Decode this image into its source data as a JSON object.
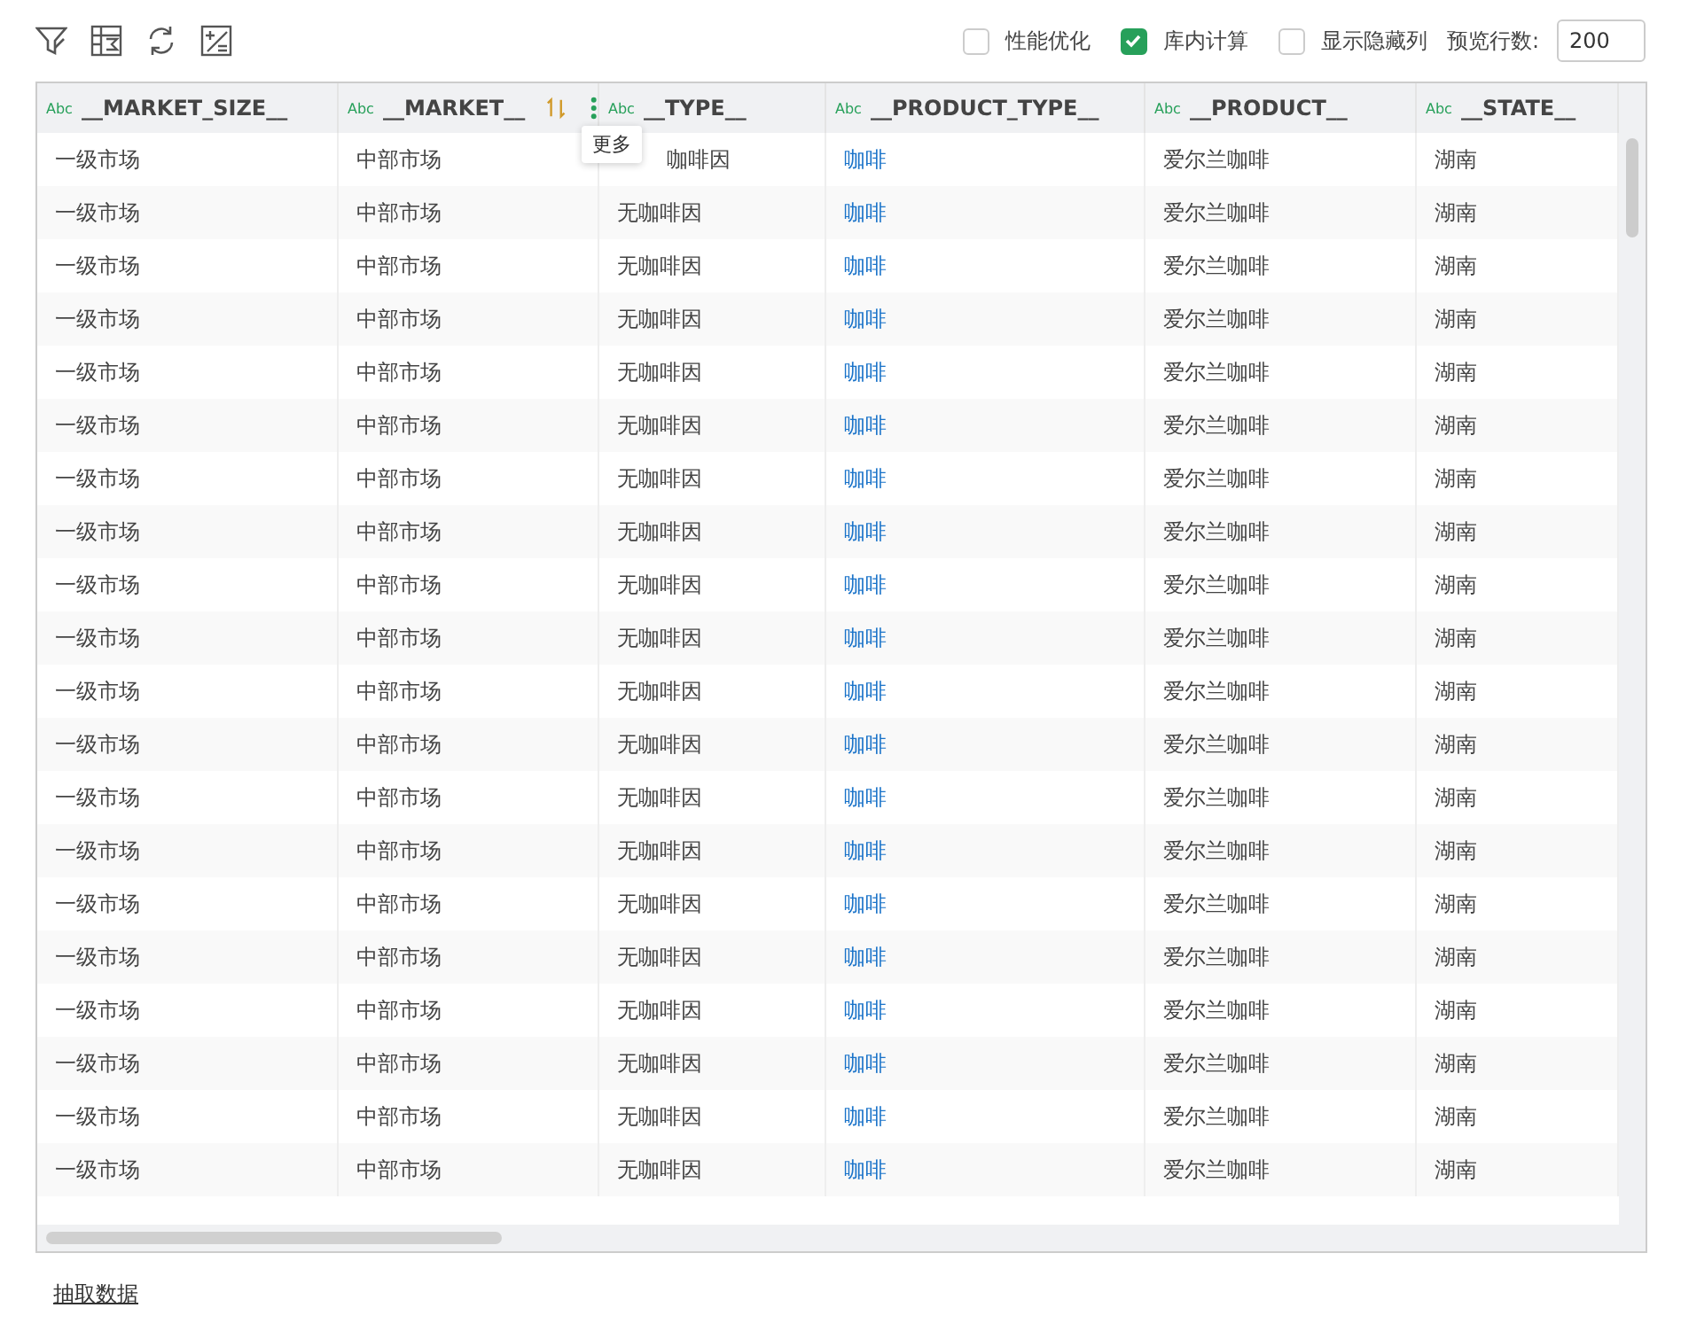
{
  "toolbar": {
    "options": [
      {
        "label": "性能优化",
        "checked": false
      },
      {
        "label": "库内计算",
        "checked": true
      },
      {
        "label": "显示隐藏列",
        "checked": false
      }
    ],
    "preview_label": "预览行数:",
    "preview_value": "200"
  },
  "table": {
    "columns": [
      {
        "type_badge": "Abc",
        "name": "__MARKET_SIZE__",
        "hovered": false
      },
      {
        "type_badge": "Abc",
        "name": "__MARKET__",
        "hovered": true
      },
      {
        "type_badge": "Abc",
        "name": "__TYPE__",
        "hovered": false
      },
      {
        "type_badge": "Abc",
        "name": "__PRODUCT_TYPE__",
        "hovered": false
      },
      {
        "type_badge": "Abc",
        "name": "__PRODUCT__",
        "hovered": false
      },
      {
        "type_badge": "Abc",
        "name": "__STATE__",
        "hovered": false
      }
    ],
    "tooltip": "更多",
    "rows": [
      [
        "一级市场",
        "中部市场",
        "咖啡因",
        "咖啡",
        "爱尔兰咖啡",
        "湖南"
      ],
      [
        "一级市场",
        "中部市场",
        "无咖啡因",
        "咖啡",
        "爱尔兰咖啡",
        "湖南"
      ],
      [
        "一级市场",
        "中部市场",
        "无咖啡因",
        "咖啡",
        "爱尔兰咖啡",
        "湖南"
      ],
      [
        "一级市场",
        "中部市场",
        "无咖啡因",
        "咖啡",
        "爱尔兰咖啡",
        "湖南"
      ],
      [
        "一级市场",
        "中部市场",
        "无咖啡因",
        "咖啡",
        "爱尔兰咖啡",
        "湖南"
      ],
      [
        "一级市场",
        "中部市场",
        "无咖啡因",
        "咖啡",
        "爱尔兰咖啡",
        "湖南"
      ],
      [
        "一级市场",
        "中部市场",
        "无咖啡因",
        "咖啡",
        "爱尔兰咖啡",
        "湖南"
      ],
      [
        "一级市场",
        "中部市场",
        "无咖啡因",
        "咖啡",
        "爱尔兰咖啡",
        "湖南"
      ],
      [
        "一级市场",
        "中部市场",
        "无咖啡因",
        "咖啡",
        "爱尔兰咖啡",
        "湖南"
      ],
      [
        "一级市场",
        "中部市场",
        "无咖啡因",
        "咖啡",
        "爱尔兰咖啡",
        "湖南"
      ],
      [
        "一级市场",
        "中部市场",
        "无咖啡因",
        "咖啡",
        "爱尔兰咖啡",
        "湖南"
      ],
      [
        "一级市场",
        "中部市场",
        "无咖啡因",
        "咖啡",
        "爱尔兰咖啡",
        "湖南"
      ],
      [
        "一级市场",
        "中部市场",
        "无咖啡因",
        "咖啡",
        "爱尔兰咖啡",
        "湖南"
      ],
      [
        "一级市场",
        "中部市场",
        "无咖啡因",
        "咖啡",
        "爱尔兰咖啡",
        "湖南"
      ],
      [
        "一级市场",
        "中部市场",
        "无咖啡因",
        "咖啡",
        "爱尔兰咖啡",
        "湖南"
      ],
      [
        "一级市场",
        "中部市场",
        "无咖啡因",
        "咖啡",
        "爱尔兰咖啡",
        "湖南"
      ],
      [
        "一级市场",
        "中部市场",
        "无咖啡因",
        "咖啡",
        "爱尔兰咖啡",
        "湖南"
      ],
      [
        "一级市场",
        "中部市场",
        "无咖啡因",
        "咖啡",
        "爱尔兰咖啡",
        "湖南"
      ],
      [
        "一级市场",
        "中部市场",
        "无咖啡因",
        "咖啡",
        "爱尔兰咖啡",
        "湖南"
      ],
      [
        "一级市场",
        "中部市场",
        "无咖啡因",
        "咖啡",
        "爱尔兰咖啡",
        "湖南"
      ]
    ]
  },
  "footer_link": "抽取数据"
}
